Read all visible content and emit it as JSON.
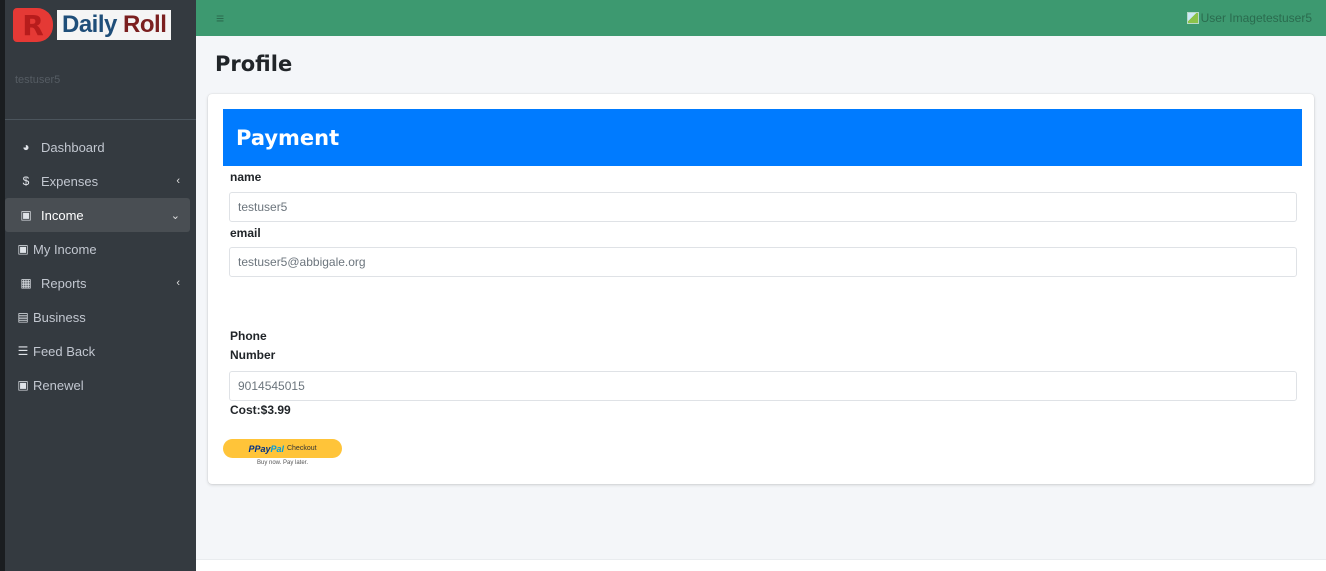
{
  "brand": {
    "letter": "R",
    "word1": "Daily",
    "word2": "Roll"
  },
  "sidebar": {
    "username": "testuser5",
    "items": [
      {
        "label": "Dashboard",
        "icon": "pie-chart-icon",
        "glyph": "◕"
      },
      {
        "label": "Expenses",
        "icon": "dollar-icon",
        "glyph": "$",
        "caret": "‹"
      },
      {
        "label": "Income",
        "icon": "money-icon",
        "glyph": "▣",
        "caret": "⌄",
        "active": true
      },
      {
        "label": "My Income",
        "icon": "money-icon",
        "glyph": "▣"
      },
      {
        "label": "Reports",
        "icon": "grid-icon",
        "glyph": "▦",
        "caret": "‹"
      },
      {
        "label": "Business",
        "icon": "credit-card-icon",
        "glyph": "▤"
      },
      {
        "label": "Feed Back",
        "icon": "list-icon",
        "glyph": "☰"
      },
      {
        "label": "Renewel",
        "icon": "user-box-icon",
        "glyph": "▣"
      }
    ]
  },
  "topbar": {
    "menu_glyph": "≡",
    "user_image_alt": "User Image",
    "username": "testuser5"
  },
  "page": {
    "title": "Profile",
    "card_title": "Payment",
    "fields": {
      "name_label": "name",
      "name_value": "testuser5",
      "email_label": "email",
      "email_value": "testuser5@abbigale.org",
      "phone_label_1": "Phone",
      "phone_label_2": "Number",
      "phone_value": "9014545015"
    },
    "cost": "Cost:$3.99",
    "paypal": {
      "p": "P ",
      "pay": "Pay",
      "pal": "Pal",
      "checkout": "Checkout",
      "tagline": "Buy now. Pay later."
    }
  },
  "colors": {
    "topbar": "#3d9970",
    "sidebar": "#343a40",
    "header": "#007bff",
    "paypal": "#ffc439"
  }
}
